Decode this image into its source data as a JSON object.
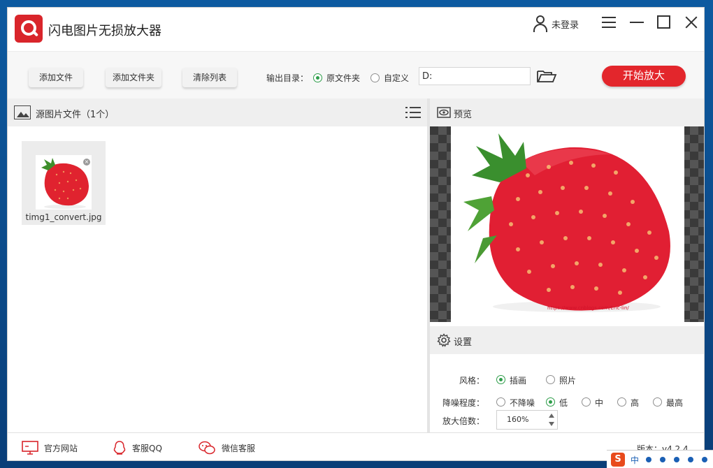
{
  "app": {
    "title": "闪电图片无损放大器",
    "user_label": "未登录"
  },
  "toolbar": {
    "add_file": "添加文件",
    "add_folder": "添加文件夹",
    "clear_list": "清除列表",
    "output_label": "输出目录：",
    "opt_source_folder": "原文件夹",
    "opt_custom": "自定义",
    "output_selected": "原文件夹",
    "path_value": "D:",
    "start_button": "开始放大"
  },
  "source": {
    "title": "源图片文件（1个）",
    "files": [
      {
        "name": "timg1_convert.jpg"
      }
    ]
  },
  "preview": {
    "title": "预览",
    "watermark_url": "https://www.cnblogs.com/Eric-lin/"
  },
  "settings": {
    "title": "设置",
    "style_label": "风格：",
    "style_options": [
      "插画",
      "照片"
    ],
    "style_selected": "插画",
    "denoise_label": "降噪程度：",
    "denoise_options": [
      "不降噪",
      "低",
      "中",
      "高",
      "最高"
    ],
    "denoise_selected": "低",
    "scale_label": "放大倍数：",
    "scale_value": "160%"
  },
  "statusbar": {
    "website": "官方网站",
    "qq": "客服QQ",
    "wechat": "微信客服",
    "version": "版本：v4.2.4"
  },
  "colors": {
    "accent_red": "#e3262c",
    "radio_green": "#2e9d4a"
  },
  "taskbar": {
    "ime_lang": "中"
  }
}
